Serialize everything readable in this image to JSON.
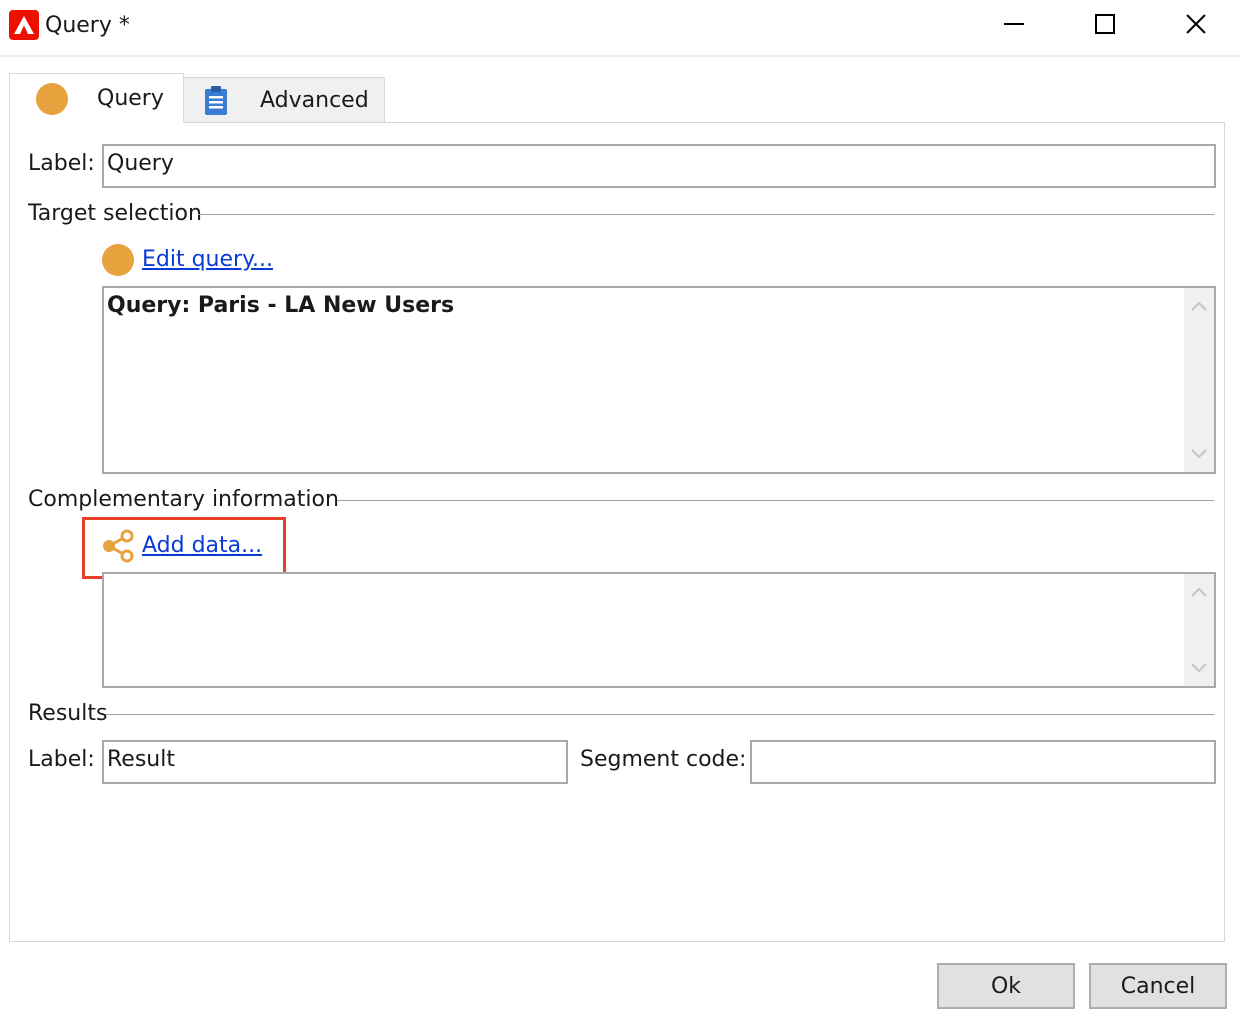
{
  "window": {
    "title": "Query *",
    "controls": [
      "minimize-icon",
      "maximize-icon",
      "close-icon"
    ]
  },
  "tabs": [
    {
      "label": "Query",
      "icon": "query-circle-icon",
      "active": true
    },
    {
      "label": "Advanced",
      "icon": "clipboard-icon",
      "active": false
    }
  ],
  "form": {
    "label_caption": "Label:",
    "label_value": "Query"
  },
  "target_selection": {
    "heading": "Target selection",
    "link": "Edit query...",
    "query_text": "Query: Paris - LA New Users"
  },
  "complementary": {
    "heading": "Complementary information",
    "link": "Add data...",
    "content": ""
  },
  "results": {
    "heading": "Results",
    "label_caption": "Label:",
    "label_value": "Result",
    "segment_caption": "Segment code:",
    "segment_value": ""
  },
  "buttons": {
    "ok": "Ok",
    "cancel": "Cancel"
  },
  "colors": {
    "accent_orange": "#e8a23d",
    "link_blue": "#0b3bd6",
    "highlight_red": "#e8402a",
    "adobe_red": "#eb1000"
  }
}
